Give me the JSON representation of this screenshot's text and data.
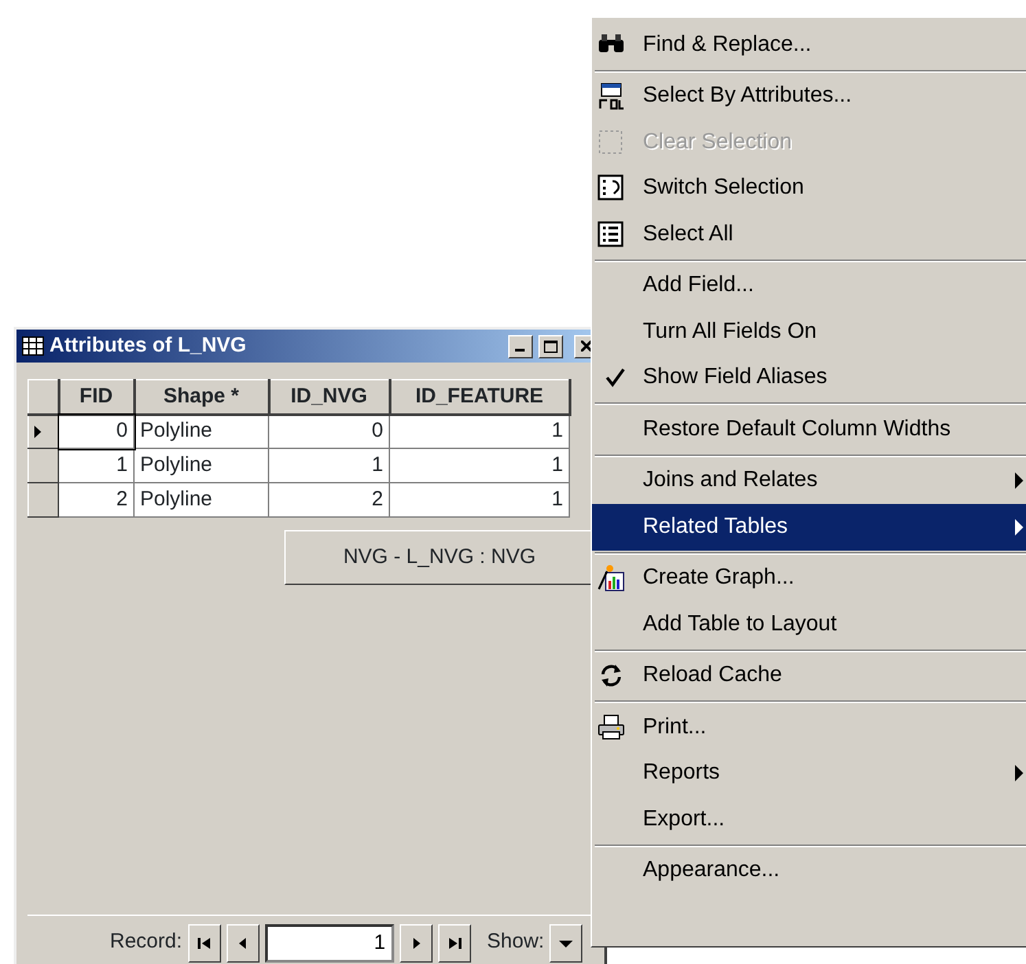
{
  "table_window": {
    "title": "Attributes of L_NVG",
    "table": {
      "columns": [
        "FID",
        "Shape *",
        "ID_NVG",
        "ID_FEATURE"
      ],
      "rows": [
        {
          "current": true,
          "cells": [
            "0",
            "Polyline",
            "0",
            "1"
          ]
        },
        {
          "current": false,
          "cells": [
            "1",
            "Polyline",
            "1",
            "1"
          ]
        },
        {
          "current": false,
          "cells": [
            "2",
            "Polyline",
            "2",
            "1"
          ]
        }
      ]
    },
    "footer": {
      "record_label": "Record:",
      "record_value": "1",
      "show_label": "Show:"
    }
  },
  "submenu": {
    "items": [
      "NVG - L_NVG : NVG"
    ]
  },
  "context_menu": {
    "groups": [
      [
        {
          "label": "Find & Replace...",
          "disabled": false,
          "checked": false,
          "submenu": false,
          "selected": false
        }
      ],
      [
        {
          "label": "Select By Attributes...",
          "disabled": false,
          "checked": false,
          "submenu": false,
          "selected": false
        },
        {
          "label": "Clear Selection",
          "disabled": true,
          "checked": false,
          "submenu": false,
          "selected": false
        },
        {
          "label": "Switch Selection",
          "disabled": false,
          "checked": false,
          "submenu": false,
          "selected": false
        },
        {
          "label": "Select All",
          "disabled": false,
          "checked": false,
          "submenu": false,
          "selected": false
        }
      ],
      [
        {
          "label": "Add Field...",
          "disabled": false,
          "checked": false,
          "submenu": false,
          "selected": false
        },
        {
          "label": "Turn All Fields On",
          "disabled": false,
          "checked": false,
          "submenu": false,
          "selected": false
        },
        {
          "label": "Show Field Aliases",
          "disabled": false,
          "checked": true,
          "submenu": false,
          "selected": false
        }
      ],
      [
        {
          "label": "Restore Default Column Widths",
          "disabled": false,
          "checked": false,
          "submenu": false,
          "selected": false
        }
      ],
      [
        {
          "label": "Joins and Relates",
          "disabled": false,
          "checked": false,
          "submenu": true,
          "selected": false
        },
        {
          "label": "Related Tables",
          "disabled": false,
          "checked": false,
          "submenu": true,
          "selected": true
        }
      ],
      [
        {
          "label": "Create Graph...",
          "disabled": false,
          "checked": false,
          "submenu": false,
          "selected": false
        },
        {
          "label": "Add Table to Layout",
          "disabled": false,
          "checked": false,
          "submenu": false,
          "selected": false
        }
      ],
      [
        {
          "label": "Reload Cache",
          "disabled": false,
          "checked": false,
          "submenu": false,
          "selected": false
        }
      ],
      [
        {
          "label": "Print...",
          "disabled": false,
          "checked": false,
          "submenu": false,
          "selected": false
        },
        {
          "label": "Reports",
          "disabled": false,
          "checked": false,
          "submenu": true,
          "selected": false
        },
        {
          "label": "Export...",
          "disabled": false,
          "checked": false,
          "submenu": false,
          "selected": false
        }
      ],
      [
        {
          "label": "Appearance...",
          "disabled": false,
          "checked": false,
          "submenu": false,
          "selected": false
        }
      ]
    ]
  }
}
